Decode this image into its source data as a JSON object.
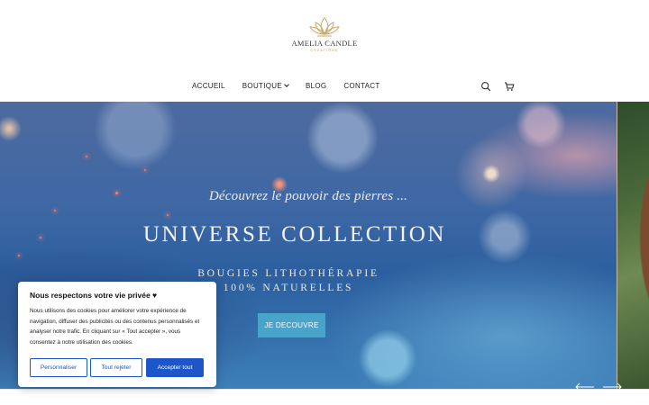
{
  "brand": {
    "name": "AMELIA CANDLE",
    "subtitle": "CREATIONS",
    "gold": "#c9a96a"
  },
  "nav": {
    "items": [
      {
        "label": "ACCUEIL"
      },
      {
        "label": "BOUTIQUE",
        "has_dropdown": true
      },
      {
        "label": "BLOG"
      },
      {
        "label": "CONTACT"
      }
    ],
    "icons": [
      "search-icon",
      "cart-icon"
    ]
  },
  "hero": {
    "tagline": "Découvrez le pouvoir des pierres ...",
    "title": "UNIVERSE COLLECTION",
    "subtitle_line1": "BOUGIES LITHOTHÉRAPIE",
    "subtitle_line2": "100% NATURELLES",
    "cta_label": "JE DECOUVRE",
    "cta_color": "#4aa3c8",
    "arrows": [
      "arrow-left-icon",
      "arrow-right-icon"
    ]
  },
  "cookie": {
    "title": "Nous respectons votre vie privée ♥",
    "text": "Nous utilisons des cookies pour améliorer votre expérience de navigation, diffuser des publicités ou des contenus personnalisés et analyser notre trafic. En cliquant sur « Tout accepter », vous consentez à notre utilisation des cookies.",
    "customize_label": "Personnaliser",
    "reject_label": "Tout rejeter",
    "accept_label": "Accepter tout",
    "accent": "#1d56c9"
  }
}
